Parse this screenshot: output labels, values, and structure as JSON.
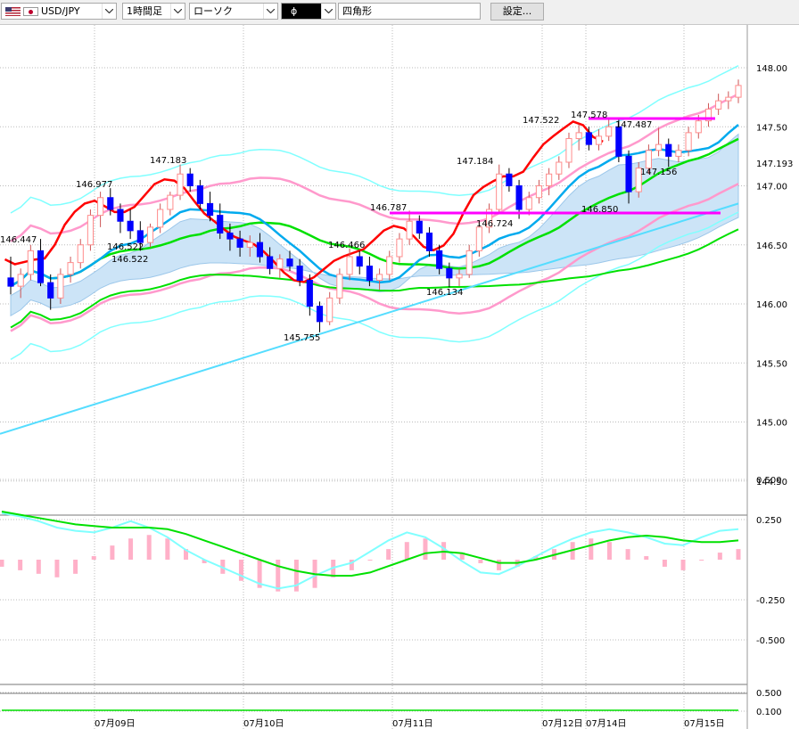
{
  "toolbar": {
    "symbol": "USD/JPY",
    "timeframe": "1時間足",
    "chart_type": "ローソク",
    "color_value": "ɸ",
    "drawing_tool": "四角形",
    "settings_label": "設定..."
  },
  "colors": {
    "up_candle": "#ff8c8c",
    "down_candle": "#0000ff",
    "ichimoku_cloud": "#cce4f7",
    "price_line_red": "#ff0000",
    "bollinger_outer": "#80ffff",
    "bollinger_inner": "#ff99cc",
    "ma_green": "#00e000",
    "ma_blue": "#00aaee",
    "ma_cyan": "#55ddff",
    "horizontal_lines": "#ff00ff",
    "macd_histogram": "#ffb0c8"
  },
  "chart_data": [
    {
      "type": "candlestick",
      "y_ticks": [
        "148.00",
        "147.50",
        "147.193",
        "147.00",
        "146.50",
        "146.00",
        "145.50",
        "145.00",
        "144.50"
      ],
      "ylim": [
        144.3,
        148.2
      ],
      "x_labels": [
        "07月09日",
        "07月10日",
        "07月11日",
        "07月12日",
        "07月14日",
        "07月15日"
      ],
      "price_annotations": [
        "146.447",
        "146.977",
        "146.522",
        "146.522",
        "147.183",
        "146.466",
        "145.755",
        "146.787",
        "146.134",
        "147.184",
        "146.724",
        "147.522",
        "147.578",
        "147.487",
        "147.156",
        "146.850"
      ],
      "candles_ohlc": [
        [
          146.22,
          146.4,
          146.08,
          146.15
        ],
        [
          146.15,
          146.3,
          146.05,
          146.25
        ],
        [
          146.25,
          146.5,
          146.2,
          146.45
        ],
        [
          146.45,
          146.55,
          146.15,
          146.18
        ],
        [
          146.18,
          146.25,
          145.95,
          146.05
        ],
        [
          146.05,
          146.3,
          146.0,
          146.25
        ],
        [
          146.25,
          146.4,
          146.18,
          146.35
        ],
        [
          146.35,
          146.55,
          146.3,
          146.5
        ],
        [
          146.5,
          146.8,
          146.45,
          146.75
        ],
        [
          146.75,
          146.95,
          146.65,
          146.9
        ],
        [
          146.9,
          146.98,
          146.75,
          146.8
        ],
        [
          146.8,
          146.85,
          146.6,
          146.7
        ],
        [
          146.7,
          146.8,
          146.55,
          146.62
        ],
        [
          146.62,
          146.7,
          146.45,
          146.52
        ],
        [
          146.52,
          146.68,
          146.48,
          146.65
        ],
        [
          146.65,
          146.85,
          146.6,
          146.8
        ],
        [
          146.8,
          146.95,
          146.75,
          146.92
        ],
        [
          146.92,
          147.18,
          146.88,
          147.1
        ],
        [
          147.1,
          147.15,
          146.95,
          147.0
        ],
        [
          147.0,
          147.05,
          146.8,
          146.85
        ],
        [
          146.85,
          146.95,
          146.7,
          146.75
        ],
        [
          146.75,
          146.85,
          146.55,
          146.6
        ],
        [
          146.6,
          146.68,
          146.45,
          146.55
        ],
        [
          146.55,
          146.62,
          146.4,
          146.48
        ],
        [
          146.48,
          146.58,
          146.4,
          146.52
        ],
        [
          146.52,
          146.6,
          146.35,
          146.4
        ],
        [
          146.4,
          146.48,
          146.25,
          146.3
        ],
        [
          146.3,
          146.42,
          146.22,
          146.38
        ],
        [
          146.38,
          146.45,
          146.28,
          146.32
        ],
        [
          146.32,
          146.38,
          146.15,
          146.2
        ],
        [
          146.2,
          146.25,
          145.9,
          145.98
        ],
        [
          145.98,
          146.02,
          145.76,
          145.85
        ],
        [
          145.85,
          146.1,
          145.82,
          146.05
        ],
        [
          146.05,
          146.3,
          146.0,
          146.25
        ],
        [
          146.25,
          146.47,
          146.2,
          146.4
        ],
        [
          146.4,
          146.45,
          146.25,
          146.32
        ],
        [
          146.32,
          146.4,
          146.15,
          146.2
        ],
        [
          146.2,
          146.3,
          146.12,
          146.25
        ],
        [
          146.25,
          146.45,
          146.2,
          146.4
        ],
        [
          146.4,
          146.6,
          146.35,
          146.55
        ],
        [
          146.55,
          146.79,
          146.5,
          146.7
        ],
        [
          146.7,
          146.75,
          146.55,
          146.6
        ],
        [
          146.6,
          146.65,
          146.4,
          146.45
        ],
        [
          146.45,
          146.5,
          146.25,
          146.3
        ],
        [
          146.3,
          146.35,
          146.14,
          146.22
        ],
        [
          146.22,
          146.3,
          146.15,
          146.25
        ],
        [
          146.25,
          146.5,
          146.22,
          146.45
        ],
        [
          146.45,
          146.7,
          146.4,
          146.65
        ],
        [
          146.65,
          146.85,
          146.6,
          146.8
        ],
        [
          146.8,
          147.18,
          146.78,
          147.1
        ],
        [
          147.1,
          147.15,
          146.95,
          147.0
        ],
        [
          147.0,
          147.05,
          146.72,
          146.8
        ],
        [
          146.8,
          146.95,
          146.75,
          146.9
        ],
        [
          146.9,
          147.05,
          146.85,
          147.0
        ],
        [
          147.0,
          147.15,
          146.92,
          147.1
        ],
        [
          147.1,
          147.25,
          147.05,
          147.2
        ],
        [
          147.2,
          147.45,
          147.15,
          147.4
        ],
        [
          147.4,
          147.52,
          147.3,
          147.45
        ],
        [
          147.45,
          147.5,
          147.3,
          147.35
        ],
        [
          147.35,
          147.48,
          147.3,
          147.42
        ],
        [
          147.42,
          147.56,
          147.38,
          147.5
        ],
        [
          147.5,
          147.58,
          147.2,
          147.25
        ],
        [
          147.25,
          147.3,
          146.85,
          146.95
        ],
        [
          146.95,
          147.2,
          146.9,
          147.15
        ],
        [
          147.15,
          147.35,
          147.1,
          147.3
        ],
        [
          147.3,
          147.49,
          147.25,
          147.35
        ],
        [
          147.35,
          147.4,
          147.16,
          147.25
        ],
        [
          147.25,
          147.35,
          147.2,
          147.3
        ],
        [
          147.3,
          147.5,
          147.25,
          147.45
        ],
        [
          147.45,
          147.6,
          147.4,
          147.55
        ],
        [
          147.55,
          147.7,
          147.5,
          147.65
        ],
        [
          147.65,
          147.78,
          147.6,
          147.72
        ],
        [
          147.72,
          147.8,
          147.65,
          147.75
        ],
        [
          147.75,
          147.9,
          147.7,
          147.85
        ]
      ]
    },
    {
      "type": "bar",
      "y_ticks": [
        "0.500",
        "0.250",
        "-0.250",
        "-0.500"
      ],
      "ylim": [
        -0.55,
        0.55
      ],
      "series": [
        {
          "values": [
            0.29,
            0.27,
            0.24,
            0.2,
            0.18,
            0.17,
            0.2,
            0.24,
            0.2,
            0.14,
            0.06,
            0.0,
            -0.05,
            -0.1,
            -0.15,
            -0.18,
            -0.16,
            -0.1,
            -0.05,
            -0.02,
            0.05,
            0.12,
            0.17,
            0.14,
            0.07,
            -0.01,
            -0.08,
            -0.09,
            -0.04,
            0.02,
            0.08,
            0.13,
            0.17,
            0.19,
            0.17,
            0.14,
            0.1,
            0.09,
            0.14,
            0.18,
            0.19
          ]
        },
        {
          "values": [
            0.3,
            0.28,
            0.26,
            0.24,
            0.22,
            0.21,
            0.2,
            0.2,
            0.2,
            0.19,
            0.16,
            0.12,
            0.08,
            0.04,
            0.0,
            -0.04,
            -0.07,
            -0.09,
            -0.1,
            -0.1,
            -0.08,
            -0.04,
            0.0,
            0.04,
            0.05,
            0.04,
            0.01,
            -0.02,
            -0.02,
            0.0,
            0.03,
            0.06,
            0.09,
            0.12,
            0.14,
            0.15,
            0.14,
            0.12,
            0.11,
            0.11,
            0.12
          ]
        },
        {
          "values": [
            -0.02,
            -0.03,
            -0.04,
            -0.05,
            -0.04,
            0.01,
            0.04,
            0.06,
            0.07,
            0.06,
            0.03,
            -0.01,
            -0.04,
            -0.06,
            -0.08,
            -0.09,
            -0.09,
            -0.08,
            -0.05,
            -0.03,
            0.0,
            0.03,
            0.05,
            0.06,
            0.05,
            0.02,
            -0.01,
            -0.03,
            -0.02,
            0.01,
            0.03,
            0.05,
            0.06,
            0.05,
            0.03,
            0.01,
            -0.02,
            -0.03,
            0.0,
            0.02,
            0.03
          ]
        }
      ]
    },
    {
      "type": "line",
      "y_ticks": [
        "0.500",
        "0.100"
      ],
      "ylim": [
        0.05,
        0.6
      ],
      "values": [
        0.12,
        0.12,
        0.12,
        0.12,
        0.12,
        0.12,
        0.12,
        0.12,
        0.12,
        0.12,
        0.12,
        0.12,
        0.12,
        0.12,
        0.12,
        0.12,
        0.12,
        0.12,
        0.12,
        0.12,
        0.12,
        0.12,
        0.12,
        0.12,
        0.12,
        0.12,
        0.12,
        0.12,
        0.12,
        0.12
      ]
    }
  ]
}
